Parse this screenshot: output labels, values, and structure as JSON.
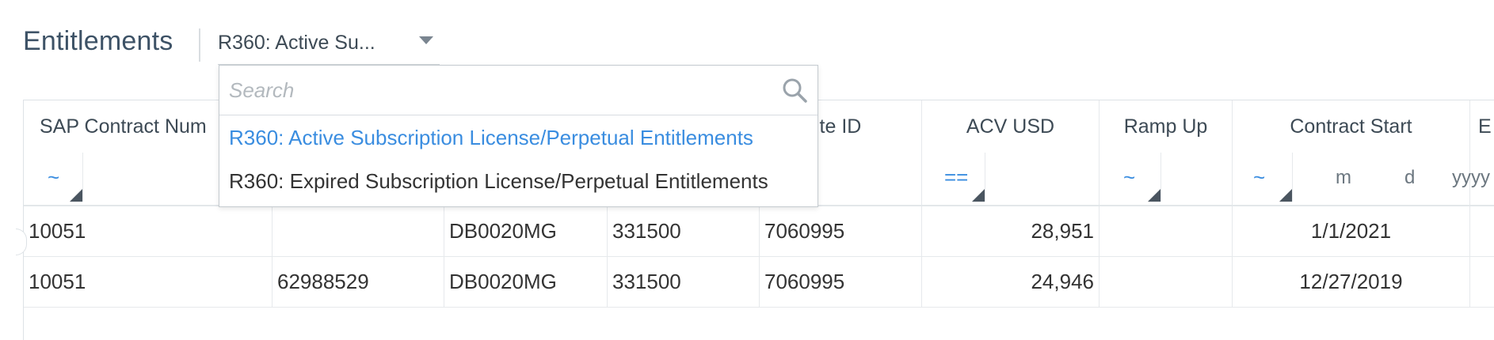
{
  "header": {
    "title": "Entitlements",
    "view_select": {
      "value": "R360: Active Su..."
    }
  },
  "dropdown": {
    "search_placeholder": "Search",
    "options": [
      {
        "label": "R360: Active Subscription License/Perpetual Entitlements",
        "selected": true
      },
      {
        "label": "R360: Expired Subscription License/Perpetual Entitlements",
        "selected": false
      }
    ]
  },
  "grid": {
    "columns": [
      {
        "label": "SAP Contract Num"
      },
      {
        "label": ""
      },
      {
        "label": ""
      },
      {
        "label": ""
      },
      {
        "label": "ite ID"
      },
      {
        "label": "ACV USD"
      },
      {
        "label": "Ramp Up"
      },
      {
        "label": "Contract Start"
      },
      {
        "label": "E"
      }
    ],
    "filters": {
      "col0_op": "~",
      "acv_op": "==",
      "ramp_op": "~",
      "start_op": "~",
      "start_month": "m",
      "start_day": "d",
      "start_year": "yyyy"
    },
    "rows": [
      [
        "10051",
        "",
        "DB0020MG",
        "331500",
        "7060995",
        "28,951",
        "",
        "1/1/2021"
      ],
      [
        "10051",
        "62988529",
        "DB0020MG",
        "331500",
        "7060995",
        "24,946",
        "",
        "12/27/2019"
      ]
    ]
  },
  "colors": {
    "accent": "#3a8de0",
    "title": "#3d5266",
    "border": "#e6e9ec"
  }
}
